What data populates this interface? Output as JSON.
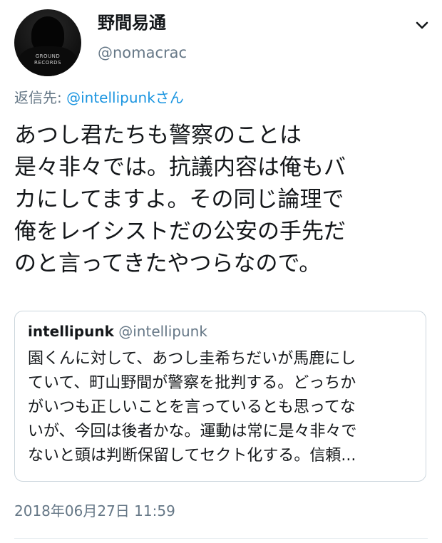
{
  "author": {
    "display_name": "野間易通",
    "handle": "@nomacrac",
    "avatar_shirt_text": "GROUND\nRECORDS"
  },
  "reply": {
    "prefix": "返信先: ",
    "mention": "@intellipunk",
    "suffix": "さん"
  },
  "tweet": {
    "lines": [
      "あつし君たちも警察のことは",
      "是々非々では。抗議内容は俺もバ",
      "カにしてますよ。その同じ論理で",
      "俺をレイシストだの公安の手先だ",
      "のと言ってきたやつらなので。"
    ]
  },
  "quoted": {
    "name": "intellipunk",
    "handle": "@intellipunk",
    "lines": [
      "園くんに対して、あつし圭希ちだいが馬鹿にし",
      "ていて、町山野間が警察を批判する。どっちか",
      "がいつも正しいことを言っているとも思ってな",
      "いが、今回は後者かな。運動は常に是々非々で",
      "ないと頭は判断保留してセクト化する。信頼..."
    ]
  },
  "timestamp": "2018年06月27日 11:59",
  "icons": {
    "menu": "chevron-down-icon",
    "avatar": "avatar"
  },
  "colors": {
    "text": "#14171a",
    "secondary": "#657786",
    "link": "#1b95e0",
    "border": "#ccd6dd"
  }
}
